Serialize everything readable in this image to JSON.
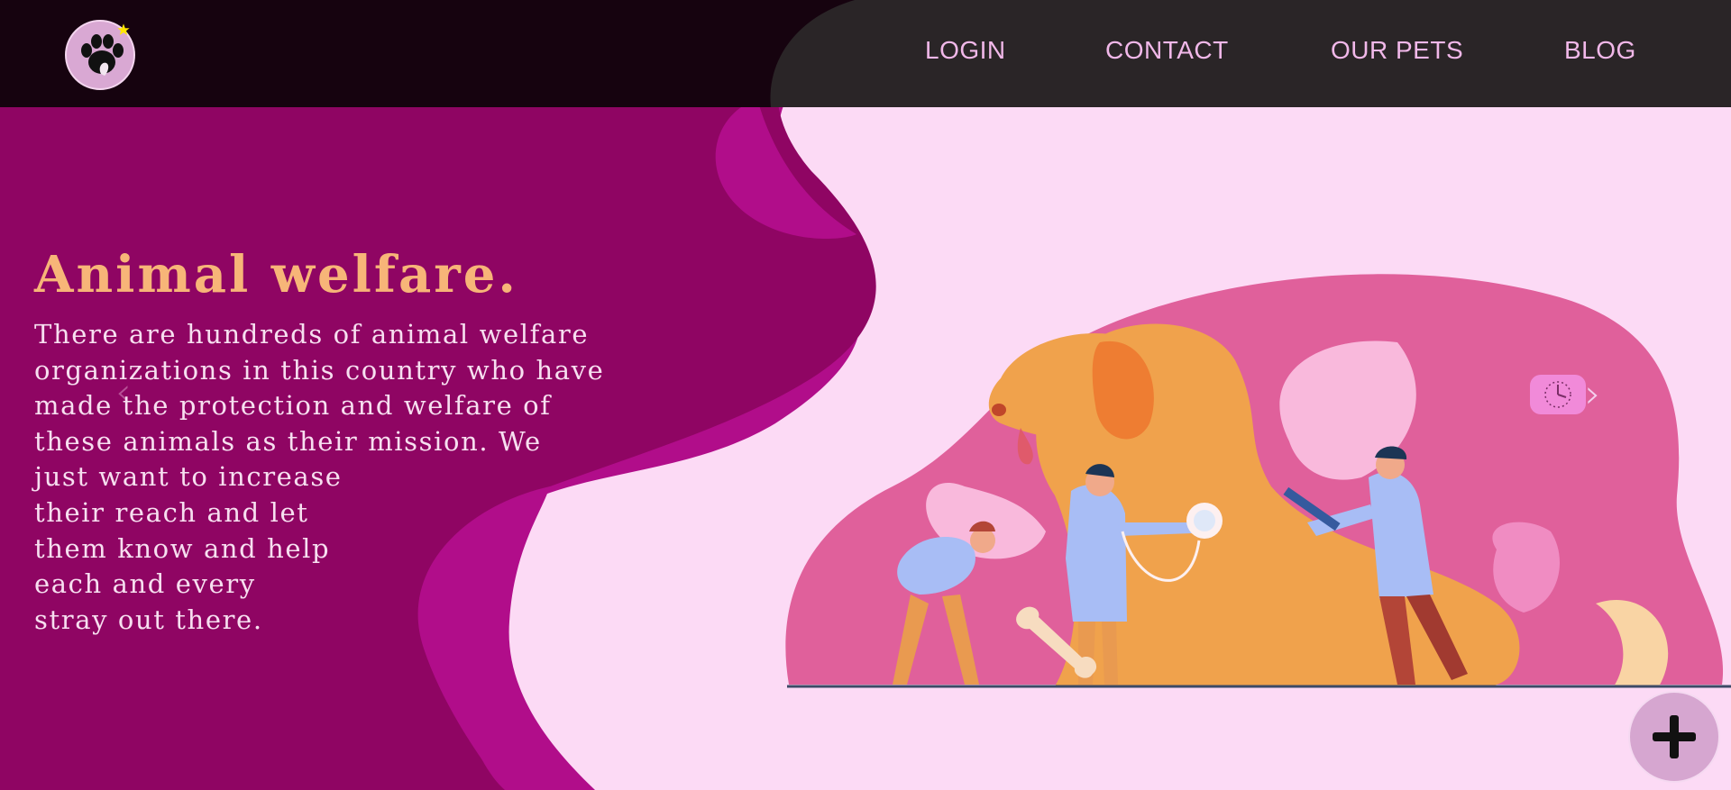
{
  "brand": {
    "logo_icon": "paw-cat-dog-logo-icon"
  },
  "nav": {
    "links": [
      {
        "label": "LOGIN"
      },
      {
        "label": "CONTACT"
      },
      {
        "label": "OUR PETS"
      },
      {
        "label": "BLOG"
      }
    ]
  },
  "hero": {
    "title": "Animal welfare.",
    "body": "There are hundreds of animal welfare\norganizations in this country who have\nmade the protection and welfare of\nthese animals as their mission. We\njust want to increase\ntheir reach and let\nthem know and help\neach and every\nstray out there."
  },
  "carousel": {
    "prev_icon": "chevron-left-icon",
    "next_icon": "chevron-right-icon",
    "badge_icon": "clock-icon"
  },
  "fab": {
    "icon": "plus-icon"
  },
  "colors": {
    "nav_dark": "#16030f",
    "nav_gray": "#2a2527",
    "nav_text": "#f1b8e9",
    "hero_purple": "#910663",
    "hero_magenta": "#b10d8a",
    "page_pink": "#fcdaf5",
    "title_orange": "#f7b578",
    "blob_pink": "#e0609b"
  }
}
